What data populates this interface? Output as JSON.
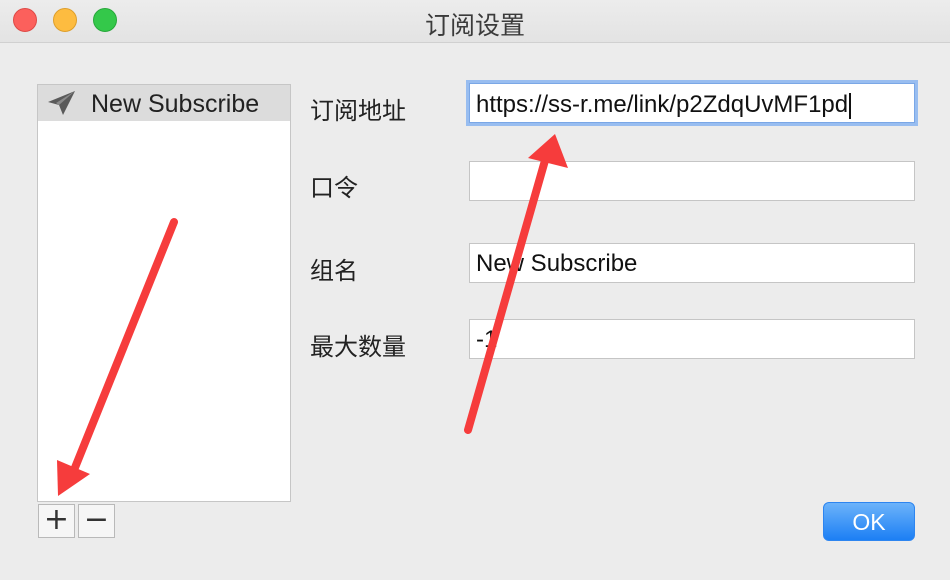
{
  "window": {
    "title": "订阅设置"
  },
  "list": {
    "items": [
      {
        "icon": "paper-plane-icon",
        "label": "New Subscribe",
        "selected": true
      }
    ]
  },
  "list_controls": {
    "add_label": "+",
    "remove_label": "−"
  },
  "form": {
    "url": {
      "label": "订阅地址",
      "value": "https://ss-r.me/link/p2ZdqUvMF1pd"
    },
    "password": {
      "label": "口令",
      "value": ""
    },
    "group": {
      "label": "组名",
      "value": "New Subscribe"
    },
    "max_count": {
      "label": "最大数量",
      "value": "-1"
    }
  },
  "ok_button": {
    "label": "OK"
  },
  "colors": {
    "accent": "#1c7ff4",
    "annotation_arrow": "#f63c3c",
    "selected_row": "#dcdcdc"
  }
}
